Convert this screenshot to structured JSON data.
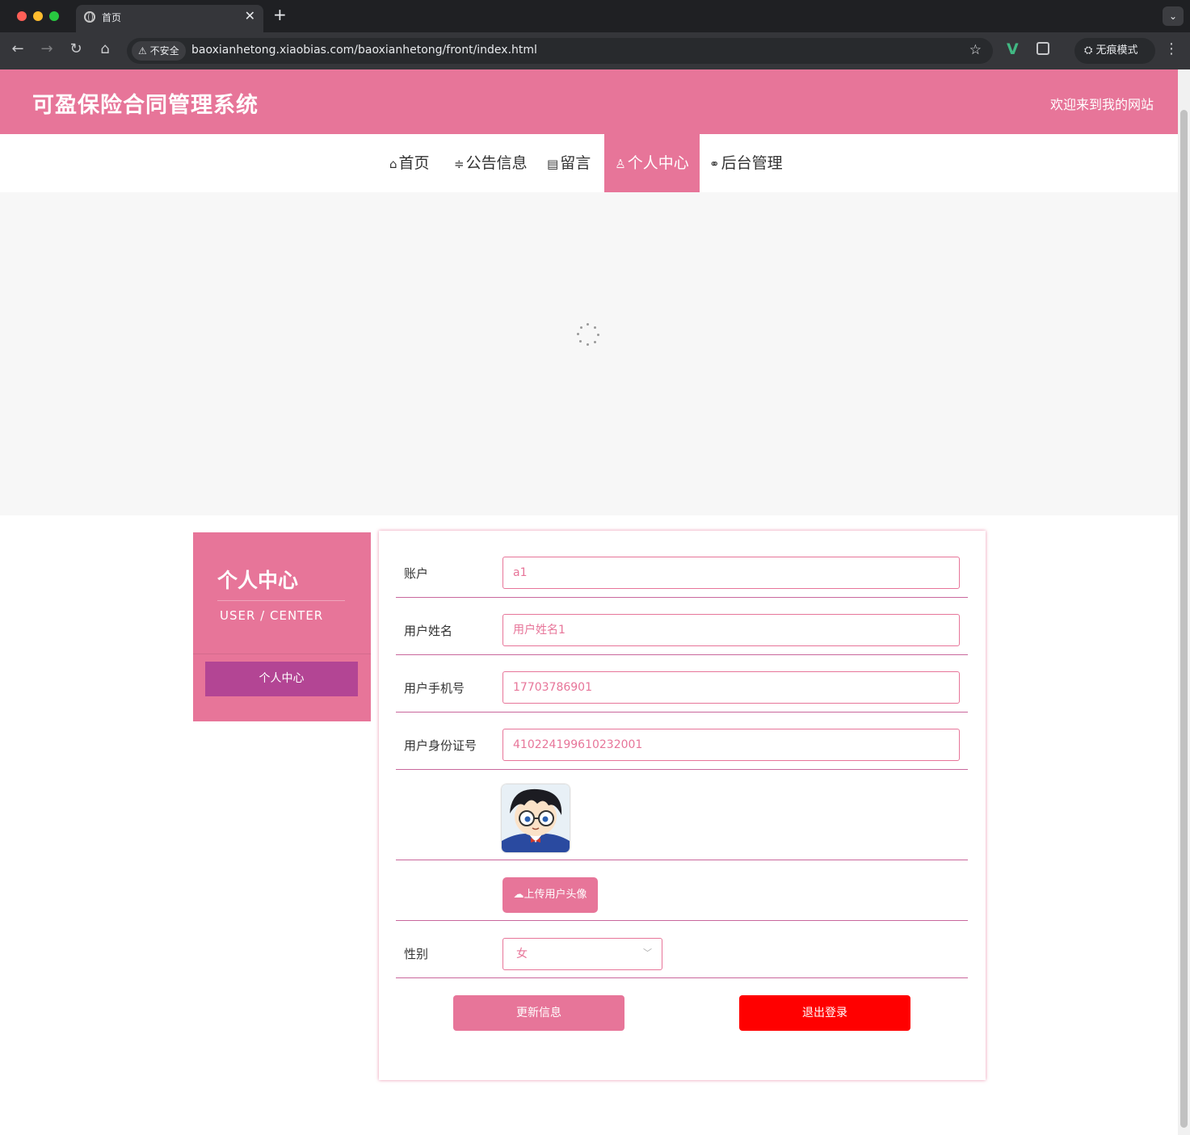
{
  "browser": {
    "tab_title": "首页",
    "tab_close": "✕",
    "new_tab": "+",
    "insecure_label": "不安全",
    "url": "baoxianhetong.xiaobias.com/baoxianhetong/front/index.html",
    "incognito_label": "无痕模式"
  },
  "header": {
    "site_title": "可盈保险合同管理系统",
    "welcome": "欢迎来到我的网站"
  },
  "nav": {
    "items": [
      {
        "label": "首页",
        "icon": "home-icon",
        "glyph": "⌂"
      },
      {
        "label": "公告信息",
        "icon": "sliders-icon",
        "glyph": "≑"
      },
      {
        "label": "留言",
        "icon": "newspaper-icon",
        "glyph": "▤"
      },
      {
        "label": "个人中心",
        "icon": "user-icon",
        "glyph": "♙"
      },
      {
        "label": "后台管理",
        "icon": "link-icon",
        "glyph": "🔗"
      }
    ],
    "active": "个人中心"
  },
  "sidebar": {
    "title": "个人中心",
    "subtitle": "USER / CENTER",
    "menu_item": "个人中心"
  },
  "form": {
    "account_label": "账户",
    "account_value": "a1",
    "name_label": "用户姓名",
    "name_value": "用户姓名1",
    "phone_label": "用户手机号",
    "phone_value": "17703786901",
    "idcard_label": "用户身份证号",
    "idcard_value": "410224199610232001",
    "upload_label": "上传用户头像",
    "gender_label": "性别",
    "gender_value": "女",
    "update_button": "更新信息",
    "logout_button": "退出登录"
  },
  "colors": {
    "brand": "#e77599",
    "sidebar_button": "#b34594",
    "danger": "#ff0000"
  }
}
